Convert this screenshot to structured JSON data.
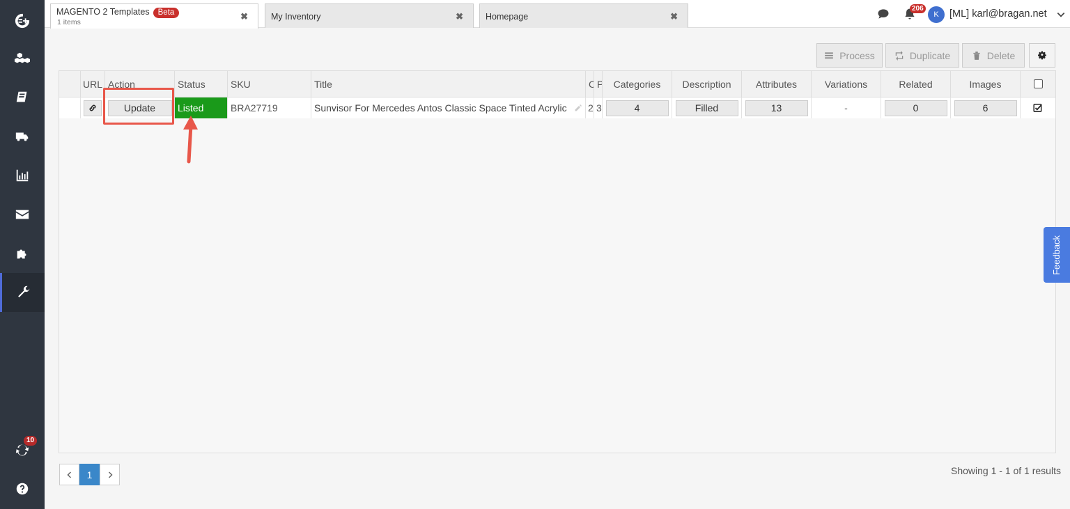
{
  "tabs": [
    {
      "title": "MAGENTO 2 Templates",
      "badge": "Beta",
      "subtitle": "1 items"
    },
    {
      "title": "My Inventory"
    },
    {
      "title": "Homepage"
    }
  ],
  "topbar": {
    "notifications_count": "206",
    "avatar_initial": "K",
    "user_label": "[ML] karl@bragan.net"
  },
  "sidebar": {
    "sync_badge": "10"
  },
  "toolbar": {
    "process_label": "Process",
    "duplicate_label": "Duplicate",
    "delete_label": "Delete"
  },
  "table": {
    "headers": {
      "url": "URL",
      "action": "Action",
      "status": "Status",
      "sku": "SKU",
      "title": "Title",
      "c": "C",
      "p": "P",
      "categories": "Categories",
      "description": "Description",
      "attributes": "Attributes",
      "variations": "Variations",
      "related": "Related",
      "images": "Images"
    },
    "row": {
      "action": "Update",
      "status": "Listed",
      "sku": "BRA27719",
      "title": "Sunvisor For Mercedes Antos Classic Space Tinted Acrylic",
      "c": "2",
      "p": "3",
      "categories": "4",
      "description": "Filled",
      "attributes": "13",
      "variations": "-",
      "related": "0",
      "images": "6"
    }
  },
  "pager": {
    "current_page": "1"
  },
  "results_text": "Showing 1 - 1 of 1 results",
  "feedback_label": "Feedback",
  "colors": {
    "sidebar": "#2f3640",
    "status_listed": "#1a9a1a",
    "accent": "#3a87c9",
    "highlight": "#e8574a",
    "feedback": "#4a7be0"
  }
}
